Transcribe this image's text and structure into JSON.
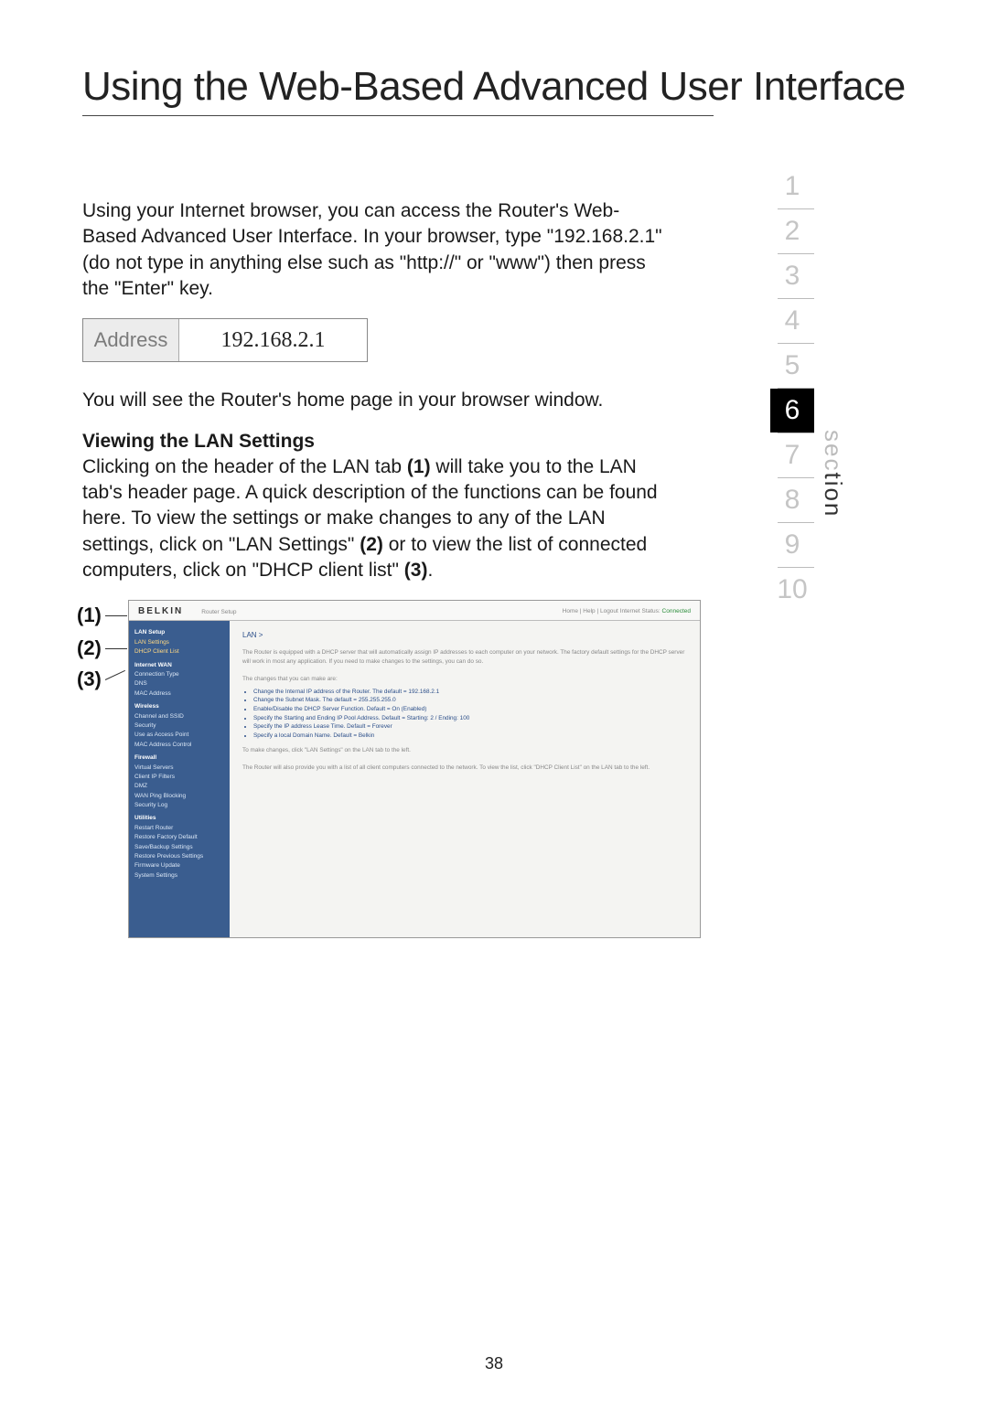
{
  "title": "Using the Web-Based Advanced User Interface",
  "intro": "Using your Internet browser, you can access the Router's Web-Based Advanced User Interface. In your browser, type \"192.168.2.1\" (do not type in anything else such as \"http://\" or \"www\") then press the \"Enter\" key.",
  "address_bar": {
    "label": "Address",
    "value": "192.168.2.1"
  },
  "after_addr": "You will see the Router's home page in your browser window.",
  "lan": {
    "heading": "Viewing the LAN Settings",
    "para_a": "Clicking on the header of the LAN tab ",
    "c1": "(1)",
    "para_b": " will take you to the LAN tab's header page. A quick description of the functions can be found here. To view the settings or make changes to any of the LAN settings, click on \"LAN Settings\" ",
    "c2": "(2)",
    "para_c": " or to view the list of connected computers, click on \"DHCP client list\" ",
    "c3": "(3)",
    "para_d": "."
  },
  "callouts": {
    "c1": "(1)",
    "c2": "(2)",
    "c3": "(3)"
  },
  "section_nav": [
    "1",
    "2",
    "3",
    "4",
    "5",
    "6",
    "7",
    "8",
    "9",
    "10"
  ],
  "section_active_index": 5,
  "section_label_grey": "sec",
  "section_label_dark": "tion",
  "page_number": "38",
  "shot": {
    "brand": "BELKIN",
    "subtitle": "Router Setup",
    "status_prefix": "Home | Help | Logout    Internet Status: ",
    "status_value": "Connected",
    "sidebar": {
      "g1": "LAN Setup",
      "i1a": "LAN Settings",
      "i1b": "DHCP Client List",
      "g2": "Internet WAN",
      "i2a": "Connection Type",
      "i2b": "DNS",
      "i2c": "MAC Address",
      "g3": "Wireless",
      "i3a": "Channel and SSID",
      "i3b": "Security",
      "i3c": "Use as Access Point",
      "i3d": "MAC Address Control",
      "g4": "Firewall",
      "i4a": "Virtual Servers",
      "i4b": "Client IP Filters",
      "i4c": "DMZ",
      "i4d": "WAN Ping Blocking",
      "i4e": "Security Log",
      "g5": "Utilities",
      "i5a": "Restart Router",
      "i5b": "Restore Factory Default",
      "i5c": "Save/Backup Settings",
      "i5d": "Restore Previous Settings",
      "i5e": "Firmware Update",
      "i5f": "System Settings"
    },
    "content": {
      "h": "LAN >",
      "p1": "The Router is equipped with a DHCP server that will automatically assign IP addresses to each computer on your network. The factory default settings for the DHCP server will work in most any application. If you need to make changes to the settings, you can do so.",
      "p2": "The changes that you can make are:",
      "b1": "Change the Internal IP address of the Router. The default = 192.168.2.1",
      "b2": "Change the Subnet Mask. The default = 255.255.255.0",
      "b3": "Enable/Disable the DHCP Server Function. Default = On (Enabled)",
      "b4": "Specify the Starting and Ending IP Pool Address. Default = Starting: 2 / Ending: 100",
      "b5": "Specify the IP address Lease Time. Default = Forever",
      "b6": "Specify a local Domain Name. Default = Belkin",
      "p3": "To make changes, click \"LAN Settings\" on the LAN tab to the left.",
      "p4": "The Router will also provide you with a list of all client computers connected to the network. To view the list, click \"DHCP Client List\" on the LAN tab to the left."
    }
  }
}
